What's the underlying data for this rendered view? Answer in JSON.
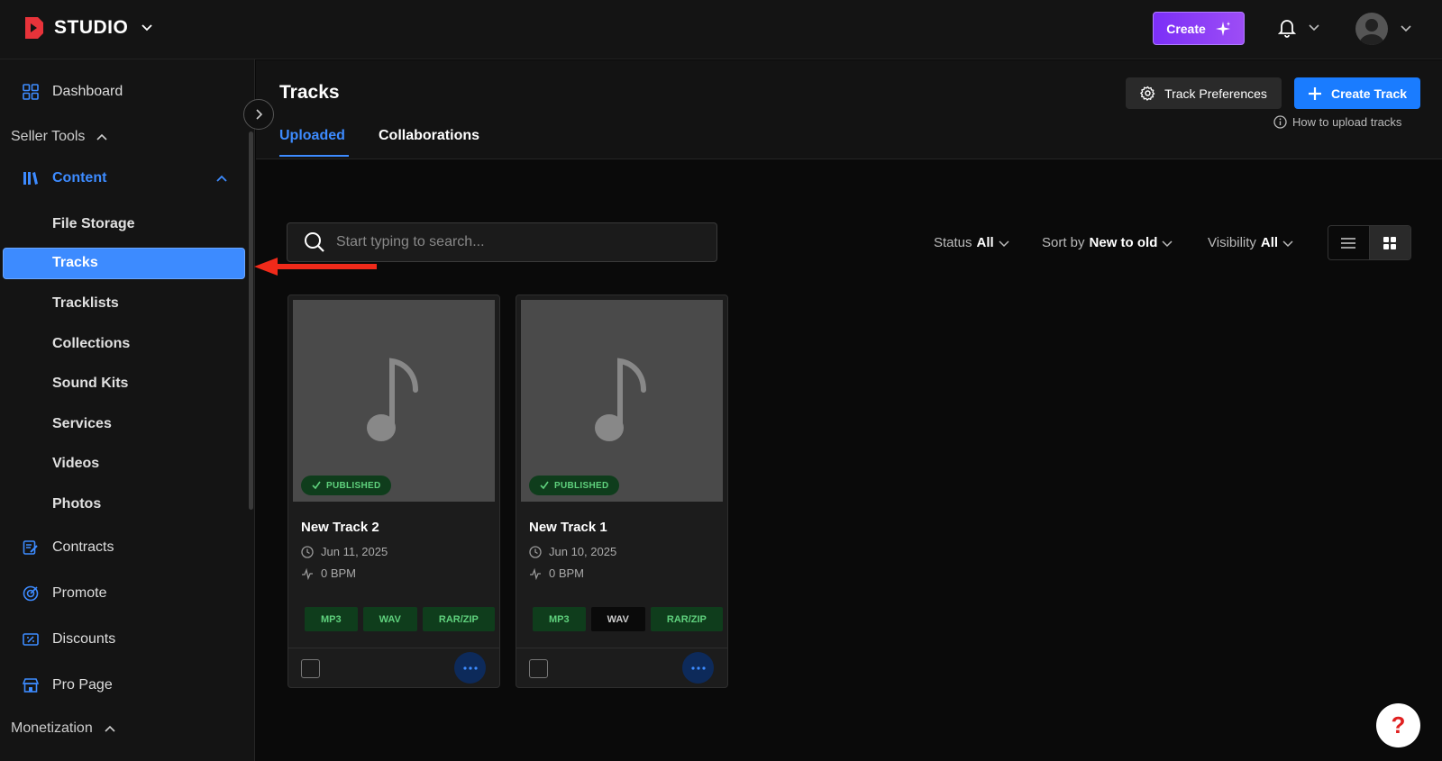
{
  "topbar": {
    "brand": "STUDIO",
    "create_label": "Create"
  },
  "sidebar": {
    "dashboard": "Dashboard",
    "seller_tools": "Seller Tools",
    "content": "Content",
    "content_items": [
      "File Storage",
      "Tracks",
      "Tracklists",
      "Collections",
      "Sound Kits",
      "Services",
      "Videos",
      "Photos"
    ],
    "contracts": "Contracts",
    "promote": "Promote",
    "discounts": "Discounts",
    "pro_page": "Pro Page",
    "monetization": "Monetization"
  },
  "header": {
    "title": "Tracks",
    "tabs": [
      "Uploaded",
      "Collaborations"
    ],
    "track_preferences": "Track Preferences",
    "create_track": "Create Track",
    "how_to": "How to upload tracks"
  },
  "toolbar": {
    "search_placeholder": "Start typing to search...",
    "status_label": "Status",
    "status_value": "All",
    "sort_label": "Sort by",
    "sort_value": "New to old",
    "visibility_label": "Visibility",
    "visibility_value": "All"
  },
  "tracks": [
    {
      "title": "New Track 2",
      "status": "PUBLISHED",
      "date": "Jun 11, 2025",
      "bpm": "0 BPM",
      "formats": [
        "MP3",
        "WAV",
        "RAR/ZIP"
      ]
    },
    {
      "title": "New Track 1",
      "status": "PUBLISHED",
      "date": "Jun 10, 2025",
      "bpm": "0 BPM",
      "formats": [
        "MP3",
        "WAV",
        "RAR/ZIP"
      ]
    }
  ],
  "colors": {
    "accent": "#3d8bff",
    "create": "#7b2ff7",
    "published": "#5fd17d"
  },
  "help": "?"
}
